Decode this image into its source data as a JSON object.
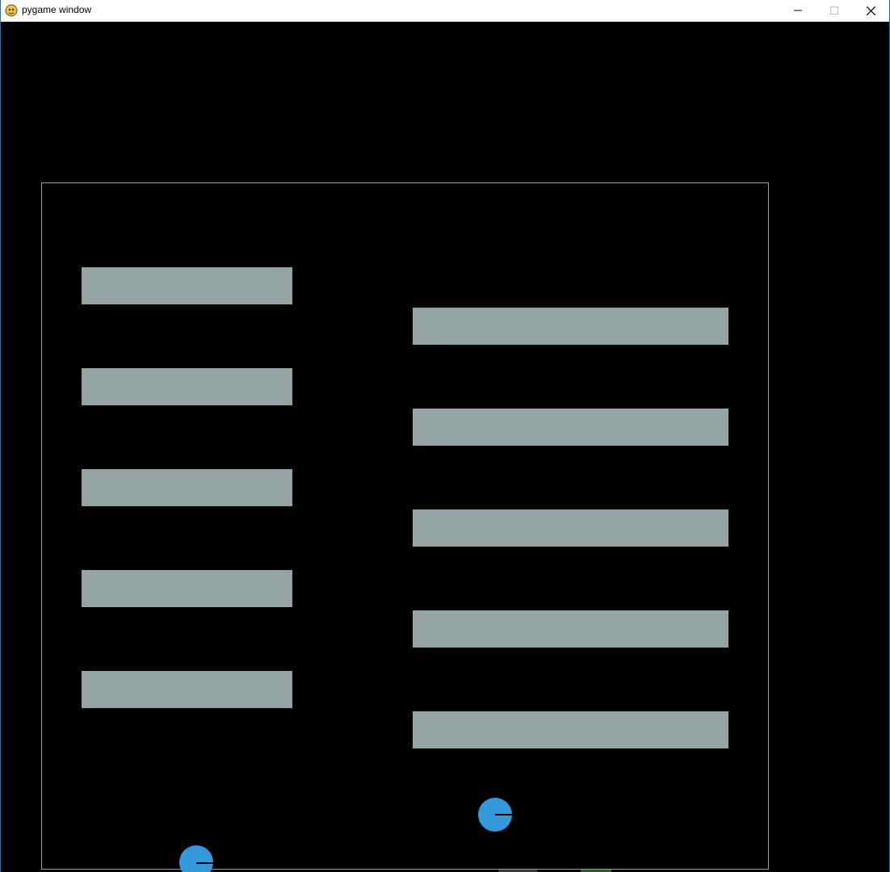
{
  "window": {
    "title": "pygame window",
    "minimize_icon": "minimize-icon",
    "maximize_icon": "maximize-icon",
    "close_icon": "close-icon"
  },
  "colors": {
    "background": "#000000",
    "arena_border": "#9aa0a0",
    "wall": "#95a5a6",
    "ball": "#3498db",
    "ball_line": "#000000"
  },
  "game": {
    "arena": "arena-border",
    "left_walls": 5,
    "right_walls": 5,
    "balls": 2
  }
}
